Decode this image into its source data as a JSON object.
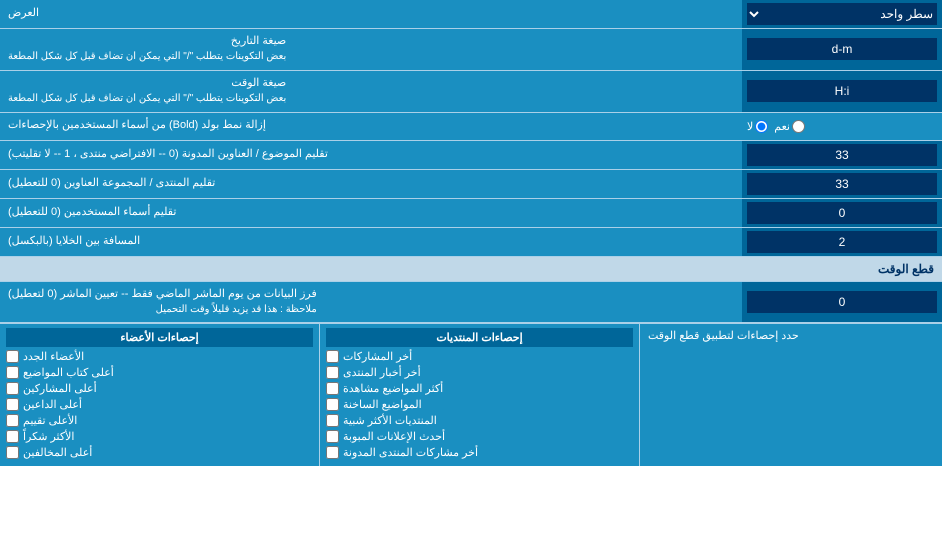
{
  "rows": [
    {
      "id": "row-عرض",
      "label": "العرض",
      "input_type": "select",
      "value": "سطر واحد",
      "options": [
        "سطر واحد"
      ]
    },
    {
      "id": "row-date-format",
      "label": "صيغة التاريخ\nبعض التكوينات يتطلب \"/\" التي يمكن ان تضاف قبل كل شكل المطعة",
      "input_type": "text",
      "value": "d-m"
    },
    {
      "id": "row-time-format",
      "label": "صيغة الوقت\nبعض التكوينات يتطلب \"/\" التي يمكن ان تضاف قبل كل شكل المطعة",
      "input_type": "text",
      "value": "H:i"
    },
    {
      "id": "row-bold",
      "label": "إزالة نمط بولد (Bold) من أسماء المستخدمين بالإحصاءات",
      "input_type": "radio",
      "radio_yes": "نعم",
      "radio_no": "لا",
      "value": "no"
    },
    {
      "id": "row-topics",
      "label": "تقليم الموضوع / العناوين المدونة (0 -- الافتراضي منتدى ، 1 -- لا تقليتب)",
      "input_type": "text",
      "value": "33"
    },
    {
      "id": "row-forum",
      "label": "تقليم المنتدى / المجموعة العناوين (0 للتعطيل)",
      "input_type": "text",
      "value": "33"
    },
    {
      "id": "row-usernames",
      "label": "تقليم أسماء المستخدمين (0 للتعطيل)",
      "input_type": "text",
      "value": "0"
    },
    {
      "id": "row-distance",
      "label": "المسافة بين الخلايا (بالبكسل)",
      "input_type": "text",
      "value": "2"
    }
  ],
  "section_cutoff": "قطع الوقت",
  "cutoff_row": {
    "label": "فرز البيانات من يوم الماشر الماضي فقط -- تعيين الماشر (0 لتعطيل)\nملاحظة : هذا قد يزيد قليلاً وقت التحميل",
    "value": "0"
  },
  "stats_header": "حدد إحصاءات لتطبيق قطع الوقت",
  "stats_col1_header": "إحصاءات المنتديات",
  "stats_col1_items": [
    "أخر المشاركات",
    "أخر أخبار المنتدى",
    "أكثر المواضيع مشاهدة",
    "المواضيع الساخنة",
    "المنتديات الأكثر شبية",
    "أحدث الإعلانات المبوبة",
    "أخر مشاركات المنتدى المدونة"
  ],
  "stats_col2_header": "إحصاءات الأعضاء",
  "stats_col2_items": [
    "الأعضاء الجدد",
    "أعلى كتاب المواضيع",
    "أعلى المشاركين",
    "أعلى الداعين",
    "الأعلى تقييم",
    "الأكثر شكراً",
    "أعلى المخالفين"
  ],
  "labels": {
    "عرض": "العرض",
    "سطر_واحد": "سطر واحد"
  }
}
